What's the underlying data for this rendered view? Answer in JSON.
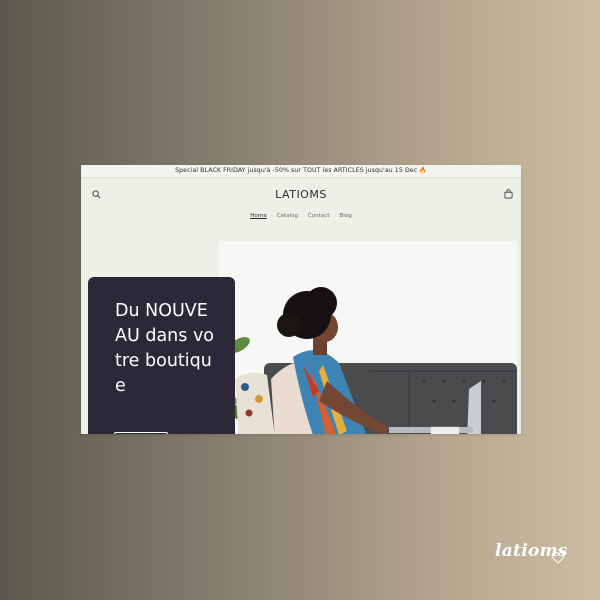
{
  "announcement": {
    "text": "Special BLACK FRIDAY jusqu'à -50% sur TOUT les ARTICLES jusqu'au 15 Dec",
    "emoji": "🔥"
  },
  "header": {
    "logo": "LATIOMS",
    "search_icon": "search-icon",
    "cart_icon": "cart-icon"
  },
  "nav": {
    "items": [
      "Home",
      "Catalog",
      "Contact",
      "Blog"
    ],
    "active": "Home"
  },
  "hero": {
    "heading": "Du NOUVEAU dans votre boutique",
    "image": "woman-with-laptop-on-sofa"
  },
  "watermark": {
    "brand": "latioms",
    "icon": "heart-icon"
  },
  "colors": {
    "card": "#2c2837",
    "page": "#eef0e8",
    "gradient_left": "#5c584d",
    "gradient_right": "#cdbda4"
  }
}
